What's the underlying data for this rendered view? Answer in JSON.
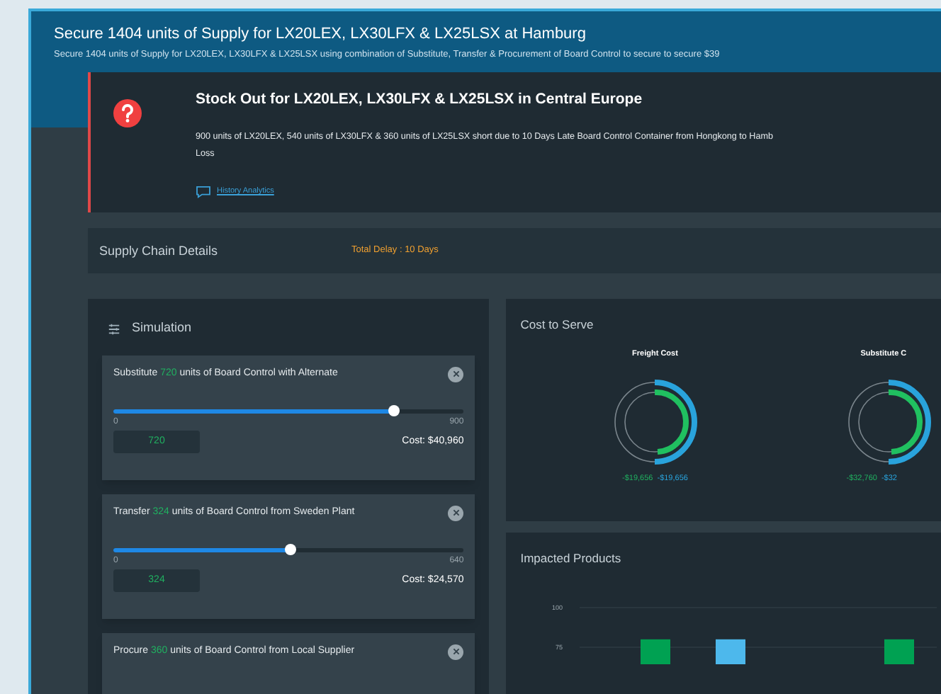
{
  "header": {
    "title": "Secure 1404 units of Supply for LX20LEX, LX30LFX & LX25LSX at Hamburg",
    "subtitle": "Secure 1404 units of Supply for LX20LEX, LX30LFX & LX25LSX using combination of Substitute, Transfer & Procurement of Board Control to secure to secure $39"
  },
  "alert": {
    "title": "Stock Out for LX20LEX, LX30LFX & LX25LSX in Central Europe",
    "body_lines": [
      "900 units of LX20LEX, 540 units of LX30LFX & 360 units of LX25LSX short due to 10 Days Late Board Control Container from Hongkong to Hamb",
      "Loss"
    ],
    "link": "History Analytics"
  },
  "supply_chain": {
    "title": "Supply Chain Details",
    "delay": "Total Delay : 10 Days"
  },
  "simulation": {
    "title": "Simulation",
    "cards": [
      {
        "before": "Substitute",
        "amount": "720",
        "after": "units of Board Control with Alternate",
        "min": "0",
        "max": "900",
        "level": 0.8,
        "value": "720",
        "cost": "Cost: $40,960"
      },
      {
        "before": "Transfer",
        "amount": "324",
        "after": "units of Board Control from Sweden Plant",
        "min": "0",
        "max": "640",
        "level": 0.506,
        "value": "324",
        "cost": "Cost: $24,570"
      },
      {
        "before": "Procure",
        "amount": "360",
        "after": "units of Board Control from Local Supplier"
      }
    ]
  },
  "cost_to_serve": {
    "title": "Cost to Serve",
    "gauges": [
      {
        "title": "Freight Cost",
        "values": [
          "-$19,656",
          "-$19,656"
        ]
      },
      {
        "title": "Substitute C",
        "values": [
          "-$32,760",
          "-$32"
        ]
      }
    ]
  },
  "impacted_products": {
    "title": "Impacted Products",
    "chart_data": {
      "type": "bar",
      "ylim": [
        64,
        100
      ],
      "yticks": [
        75,
        100
      ],
      "series": [
        {
          "color": "#00a152",
          "values": [
            80,
            80
          ]
        },
        {
          "color": "#4db8ec",
          "values": [
            80,
            null
          ]
        }
      ]
    }
  }
}
